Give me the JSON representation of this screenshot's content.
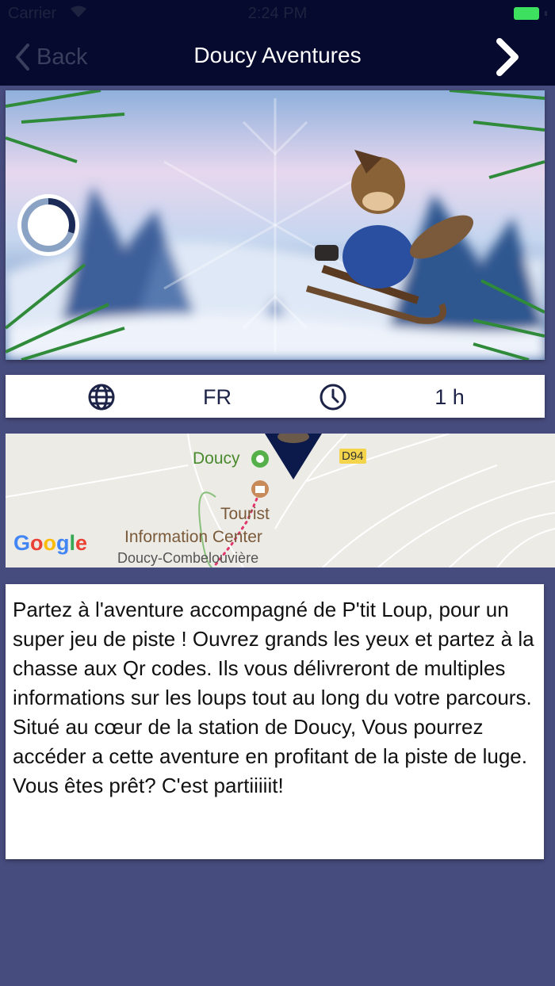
{
  "status": {
    "carrier": "Carrier",
    "time": "2:24 PM"
  },
  "nav": {
    "back_label": "Back",
    "title": "Doucy Aventures"
  },
  "hero": {
    "progress": 0.3
  },
  "info": {
    "language": "FR",
    "duration": "1 h"
  },
  "map": {
    "place_doucy": "Doucy",
    "road": "D94",
    "poi_line1": "Tourist",
    "poi_line2": "Information Center",
    "place_combe": "Doucy-Combelouvière",
    "google": "Google"
  },
  "description": "Partez à l'aventure accompagné de P'tit Loup, pour un super jeu de piste ! Ouvrez grands les yeux et partez à la chasse aux Qr codes. Ils vous délivreront de multiples informations sur les loups tout au long du votre parcours. Situé au cœur de la station de Doucy, Vous pourrez accéder a cette aventure en profitant de la piste de luge. Vous êtes prêt? C'est partiiiiit!"
}
